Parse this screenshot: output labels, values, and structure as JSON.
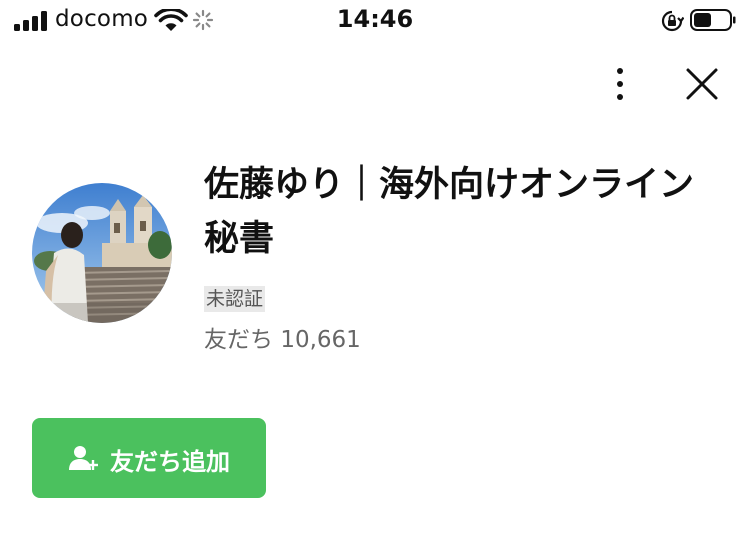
{
  "status_bar": {
    "carrier": "docomo",
    "time": "14:46"
  },
  "profile": {
    "name": "佐藤ゆり｜海外向けオンライン秘書",
    "verification_badge": "未認証",
    "friends_label": "友だち",
    "friends_count": "10,661"
  },
  "actions": {
    "add_friend_label": "友だち追加"
  },
  "colors": {
    "accent_green": "#4bc15e",
    "badge_bg": "#e9e9e9"
  },
  "icons": {
    "more": "more-vertical-icon",
    "close": "close-icon",
    "add_friend": "add-user-icon"
  }
}
